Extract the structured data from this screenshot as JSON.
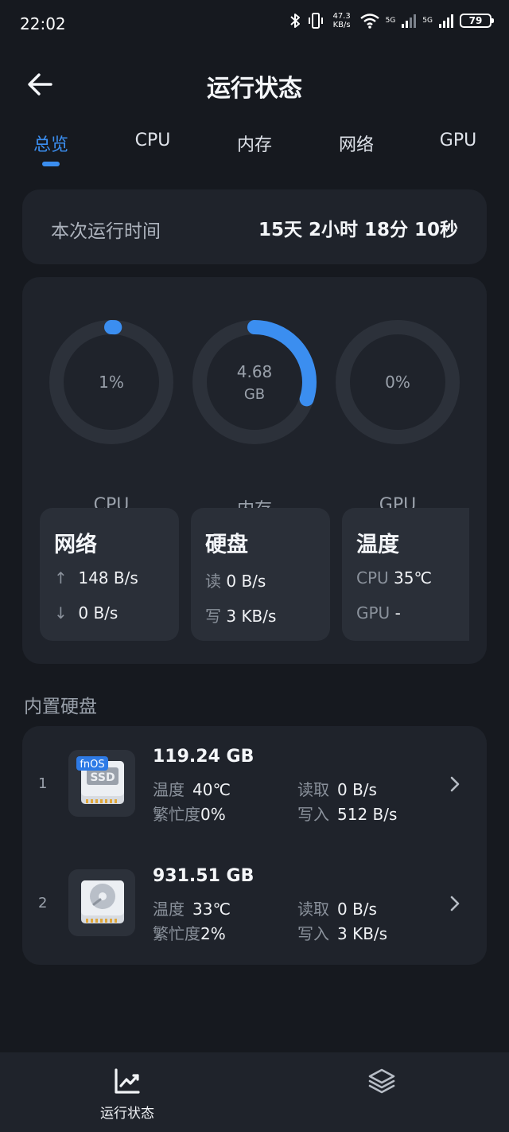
{
  "status_bar": {
    "time": "22:02",
    "net_speed_value": "47.3",
    "net_speed_unit": "KB/s",
    "sim1": "5G",
    "sim2": "5G",
    "battery": "79"
  },
  "header": {
    "title": "运行状态"
  },
  "tabs": [
    {
      "label": "总览",
      "active": true
    },
    {
      "label": "CPU",
      "active": false
    },
    {
      "label": "内存",
      "active": false
    },
    {
      "label": "网络",
      "active": false
    },
    {
      "label": "GPU",
      "active": false
    }
  ],
  "uptime": {
    "label": "本次运行时间",
    "value": "15天 2小时 18分 10秒"
  },
  "gauges": {
    "cpu": {
      "text": "1%",
      "label": "CPU",
      "fraction": 0.01
    },
    "memory": {
      "value": "4.68",
      "unit": "GB",
      "label": "内存",
      "fraction": 0.3
    },
    "gpu": {
      "text": "0%",
      "label": "GPU",
      "fraction": 0
    }
  },
  "network": {
    "title": "网络",
    "up": "148 B/s",
    "down": "0 B/s"
  },
  "disk_io": {
    "title": "硬盘",
    "read_key": "读",
    "read": "0 B/s",
    "write_key": "写",
    "write": "3 KB/s"
  },
  "temperature": {
    "title": "温度",
    "cpu_key": "CPU",
    "cpu": "35℃",
    "gpu_key": "GPU",
    "gpu": "-"
  },
  "internal_disks": {
    "title": "内置硬盘",
    "labels": {
      "temp": "温度",
      "busy": "繁忙度",
      "read": "读取",
      "write": "写入"
    },
    "items": [
      {
        "index": "1",
        "badge": "fnOS",
        "chip": "SSD",
        "capacity": "119.24 GB",
        "temp": "40℃",
        "busy": "0%",
        "read": "0 B/s",
        "write": "512 B/s"
      },
      {
        "index": "2",
        "capacity": "931.51 GB",
        "temp": "33℃",
        "busy": "2%",
        "read": "0 B/s",
        "write": "3 KB/s"
      }
    ]
  },
  "bottom_nav": {
    "items": [
      {
        "label": "运行状态",
        "icon": "line-chart-icon",
        "active": true
      },
      {
        "label": "",
        "icon": "layers-icon",
        "active": false
      }
    ]
  },
  "colors": {
    "accent": "#3b8ef0",
    "background": "#16191f",
    "card": "#1f232b",
    "tile": "#2a2f38",
    "ring_track": "#2c313a"
  }
}
